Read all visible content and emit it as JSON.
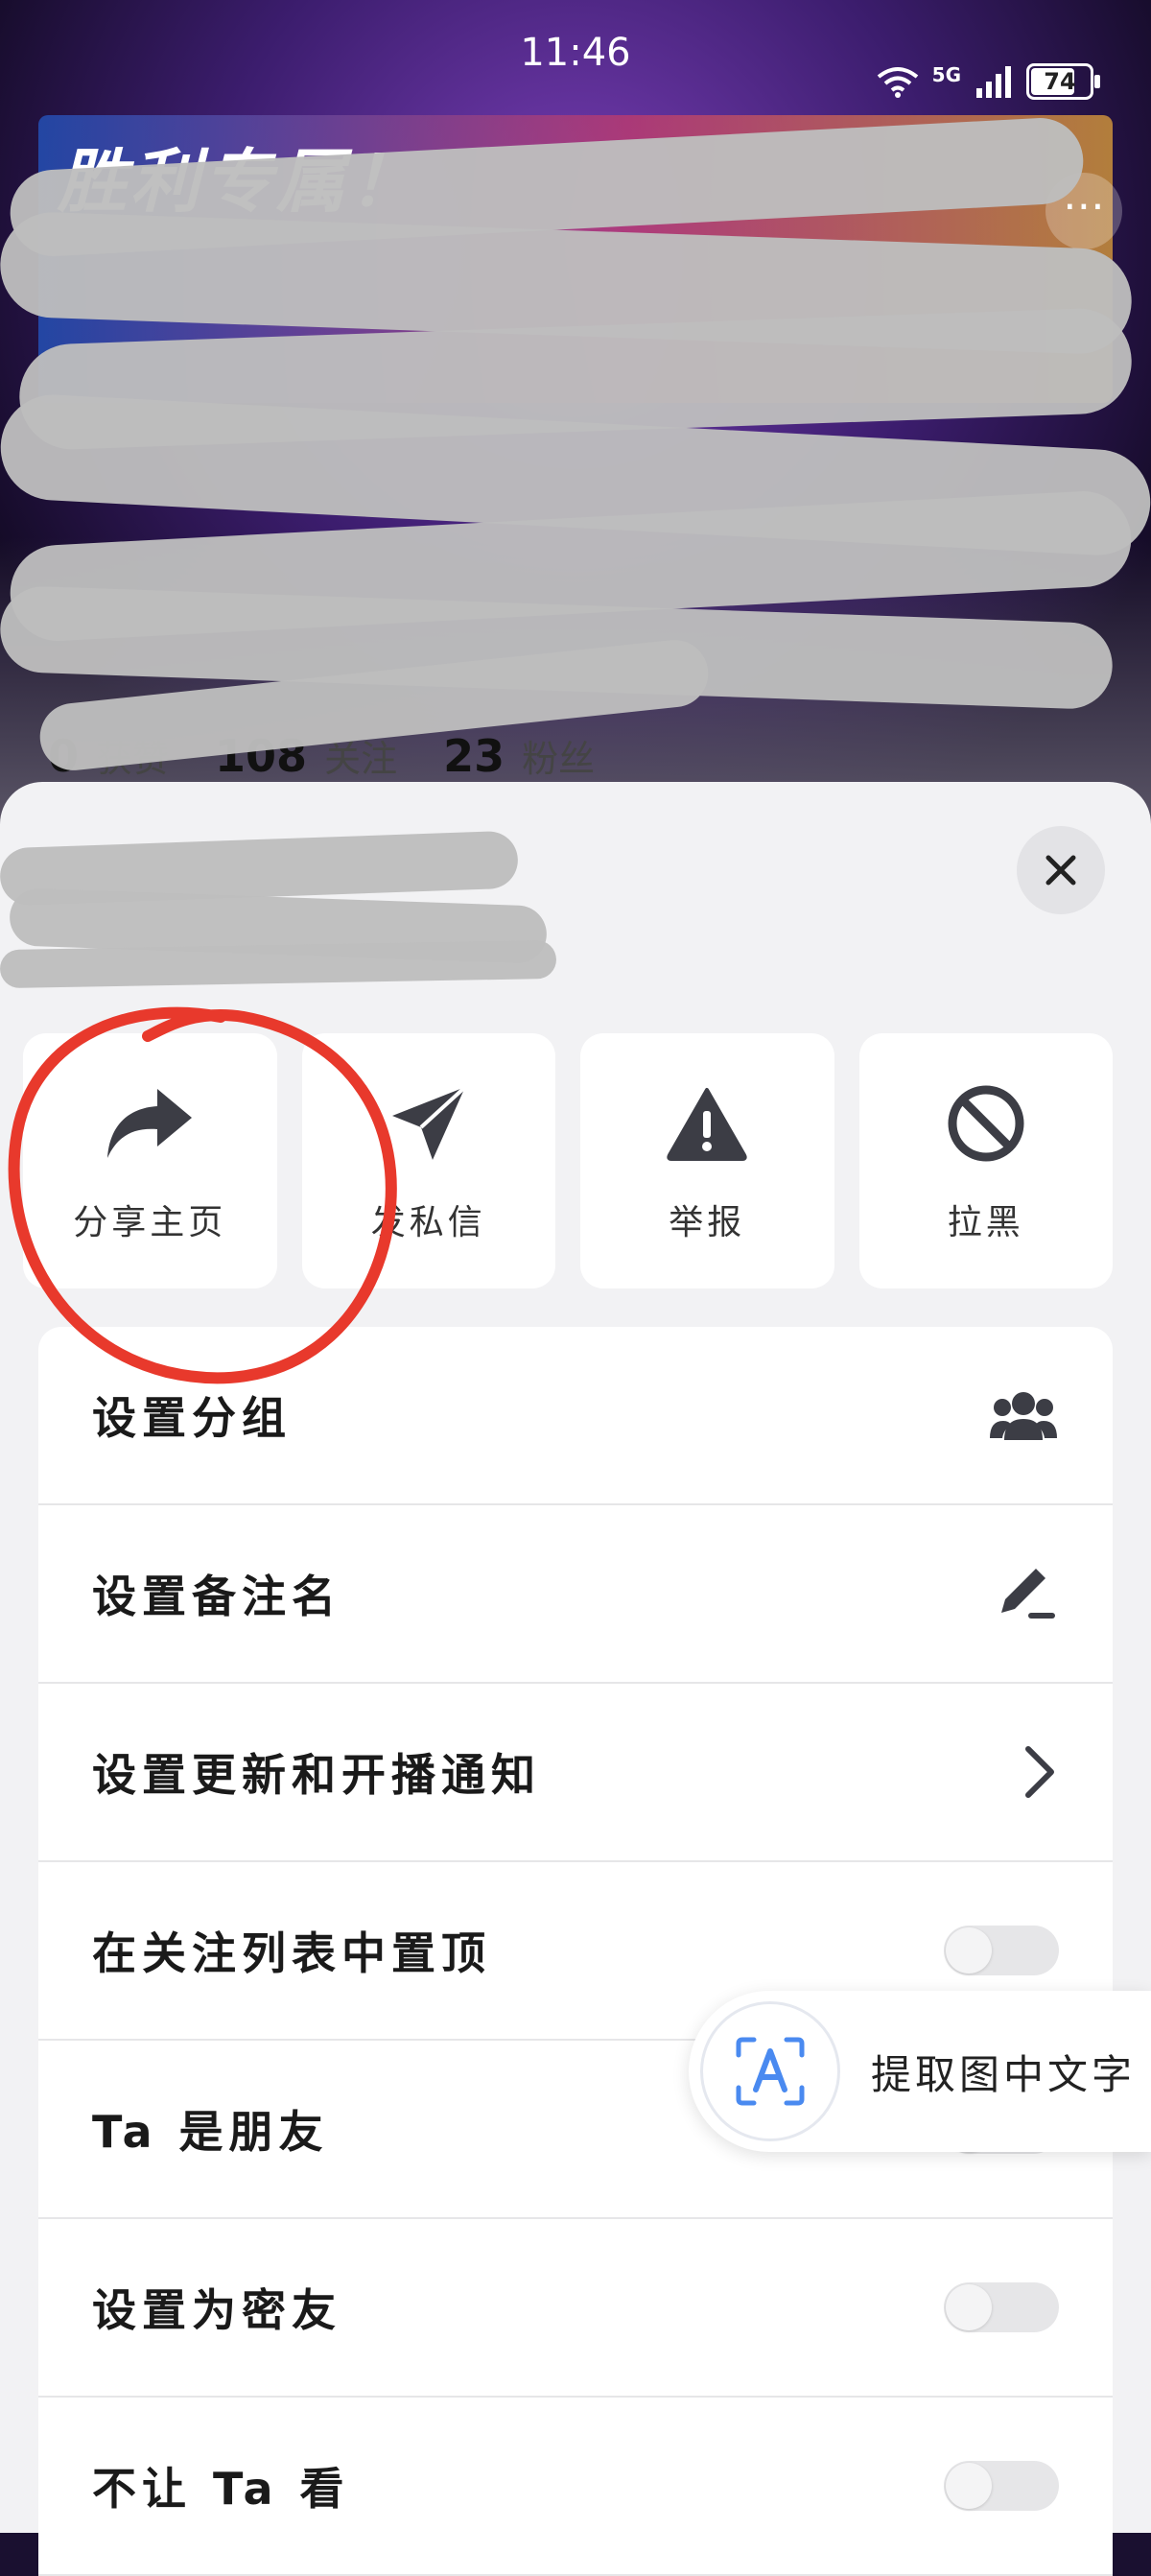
{
  "status_bar": {
    "time": "11:46",
    "network": "5G",
    "battery": "74"
  },
  "profile": {
    "banner_text": "胜利专属！",
    "stats": [
      {
        "value": "0",
        "label": "获赞"
      },
      {
        "value": "108",
        "label": "关注"
      },
      {
        "value": "23",
        "label": "粉丝"
      }
    ]
  },
  "sheet": {
    "actions": [
      {
        "label": "分享主页",
        "icon": "share-icon"
      },
      {
        "label": "发私信",
        "icon": "send-message-icon"
      },
      {
        "label": "举报",
        "icon": "warning-icon"
      },
      {
        "label": "拉黑",
        "icon": "block-icon"
      }
    ],
    "rows": [
      {
        "label": "设置分组",
        "control": "group-icon"
      },
      {
        "label": "设置备注名",
        "control": "edit-icon"
      },
      {
        "label": "设置更新和开播通知",
        "control": "chevron-right-icon"
      },
      {
        "label": "在关注列表中置顶",
        "control": "toggle",
        "on": false
      },
      {
        "label": "Ta 是朋友",
        "control": "toggle",
        "on": false
      },
      {
        "label": "设置为密友",
        "control": "toggle",
        "on": false
      },
      {
        "label": "不让 Ta 看",
        "control": "toggle",
        "on": false
      }
    ]
  },
  "ocr_bubble": {
    "label": "提取图中文字",
    "icon": "text-recognition-icon"
  },
  "colors": {
    "sheet_bg": "#f2f2f4",
    "card_bg": "#ffffff",
    "icon_dark": "#3c3d45",
    "annotation_red": "#e8392c",
    "ocr_blue": "#4a8af0"
  }
}
